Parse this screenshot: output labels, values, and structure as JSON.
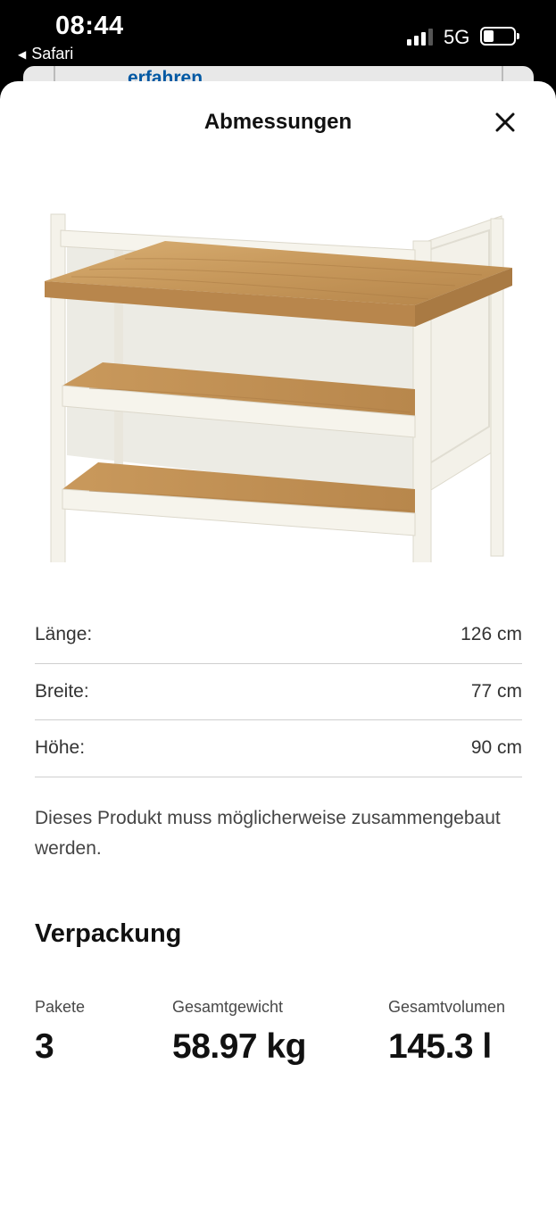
{
  "status_bar": {
    "time": "08:44",
    "back_app": "Safari",
    "network": "5G",
    "battery_level": 0.35
  },
  "underlay": {
    "link_text": "erfahren"
  },
  "sheet": {
    "title": "Abmessungen"
  },
  "dimensions": [
    {
      "label": "Länge:",
      "value": "126 cm"
    },
    {
      "label": "Breite:",
      "value": "77 cm"
    },
    {
      "label": "Höhe:",
      "value": "90 cm"
    }
  ],
  "assembly_note": "Dieses Produkt muss möglicherweise zusammengebaut werden.",
  "packaging": {
    "heading": "Verpackung",
    "packages_label": "Pakete",
    "packages_value": "3",
    "weight_label": "Gesamtgewicht",
    "weight_value": "58.97 kg",
    "volume_label": "Gesamtvolumen",
    "volume_value": "145.3 l"
  },
  "colors": {
    "link": "#0058a3",
    "wood": "#c89a5c",
    "frame": "#f1efe6"
  }
}
